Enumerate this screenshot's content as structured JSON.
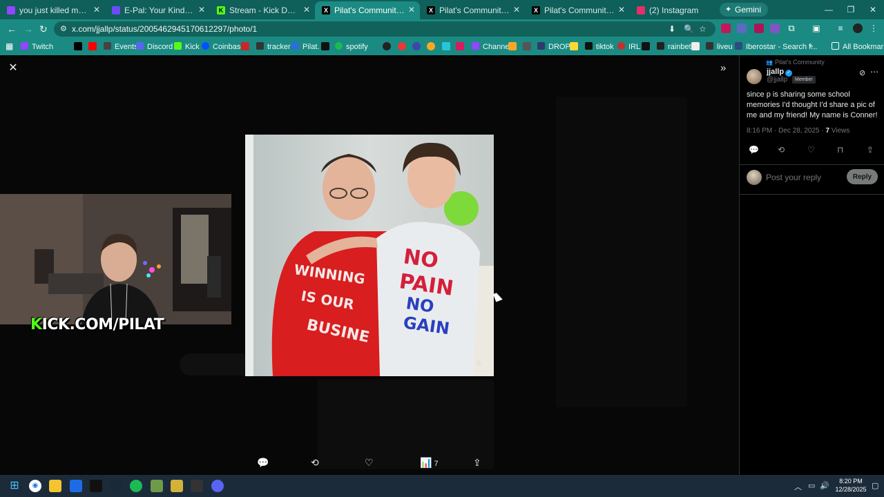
{
  "browser": {
    "tabs": [
      {
        "label": "you just killed me you - Twitc",
        "favicon_color": "#9146ff"
      },
      {
        "label": "E-Pal: Your Kind Teammates",
        "favicon_color": "#6b4cf6"
      },
      {
        "label": "Stream - Kick Dashboard",
        "favicon_color": "#53fc18"
      },
      {
        "label": "Pilat's Community Communi",
        "favicon_color": "#000000"
      },
      {
        "label": "Pilat's Community Communi",
        "favicon_color": "#000000"
      },
      {
        "label": "Pilat's Community Communi",
        "favicon_color": "#000000"
      },
      {
        "label": "(2) Instagram",
        "favicon_color": "#e1306c"
      }
    ],
    "gemini_label": "Gemini",
    "url": "x.com/jjallp/status/2005462945170612297/photo/1"
  },
  "bookmarks": {
    "items": [
      {
        "label": "Twitch",
        "color": "#9146ff"
      },
      {
        "label": "Events",
        "color": "#444444"
      },
      {
        "label": "Discord",
        "color": "#5865f2"
      },
      {
        "label": "Kick",
        "color": "#53fc18"
      },
      {
        "label": "Coinbase",
        "color": "#0052ff"
      },
      {
        "label": "tracker",
        "color": "#333333"
      },
      {
        "label": "Pilat.",
        "color": "#2a6fdb"
      },
      {
        "label": "spotify",
        "color": "#1db954"
      },
      {
        "label": "Channel",
        "color": "#9146ff"
      },
      {
        "label": "DROP",
        "color": "#2d3b6b"
      },
      {
        "label": "tiktok",
        "color": "#111111"
      },
      {
        "label": "IRL",
        "color": "#c4302b"
      },
      {
        "label": "rainbet",
        "color": "#222222"
      },
      {
        "label": "liveu",
        "color": "#333333"
      },
      {
        "label": "Iberostar - Search f...",
        "color": "#2b4c7e"
      }
    ],
    "all_bookmarks": "All Bookmarks"
  },
  "viewer": {
    "actions": {
      "views_count": "7"
    }
  },
  "overlay": {
    "kick_prefix": "K",
    "kick_rest": "ICK.COM/PILAT"
  },
  "post": {
    "community": "Pilat's Community",
    "username": "jjallp",
    "handle": "@jjallp",
    "badge": "Member",
    "text": "since p is sharing some school memories I'd thought I'd share a pic of me and my friend! My name is Conner!",
    "time": "8:16 PM · Dec 28, 2025 · ",
    "views_count": "7",
    "views_label": " Views",
    "reply_placeholder": "Post your reply",
    "reply_button": "Reply"
  },
  "taskbar": {
    "time": "8:20 PM",
    "date": "12/28/2025"
  },
  "colors": {
    "tab_bar": "#0f5f5a",
    "toolbar": "#1b8a82",
    "x_blue": "#1d9bf0",
    "kick_green": "#53fc18"
  }
}
